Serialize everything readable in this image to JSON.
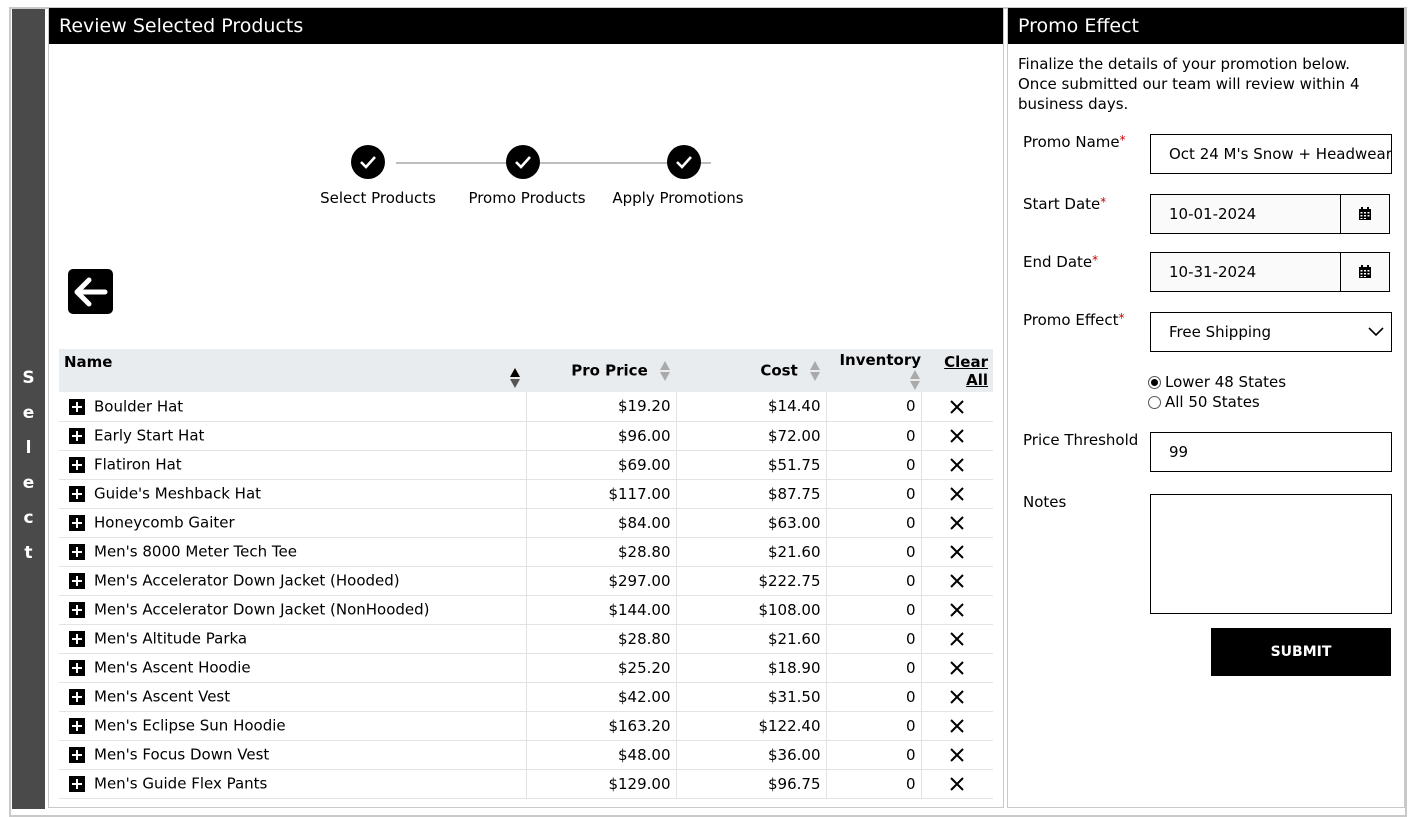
{
  "side_tab": {
    "letters": [
      "S",
      "e",
      "l",
      "e",
      "c",
      "t"
    ]
  },
  "left_panel": {
    "title": "Review Selected Products",
    "steps": [
      {
        "label": "Select Products",
        "done": true
      },
      {
        "label": "Promo Products",
        "done": true
      },
      {
        "label": "Apply Promotions",
        "done": true
      }
    ],
    "back_icon": "arrow-left-icon",
    "table": {
      "headers": {
        "name": "Name",
        "pro_price": "Pro Price",
        "cost": "Cost",
        "inventory": "Inventory",
        "clear_all": "Clear All"
      },
      "rows": [
        {
          "name": "Boulder Hat",
          "pro_price": "$19.20",
          "cost": "$14.40",
          "inventory": "0"
        },
        {
          "name": "Early Start Hat",
          "pro_price": "$96.00",
          "cost": "$72.00",
          "inventory": "0"
        },
        {
          "name": "Flatiron Hat",
          "pro_price": "$69.00",
          "cost": "$51.75",
          "inventory": "0"
        },
        {
          "name": "Guide's Meshback Hat",
          "pro_price": "$117.00",
          "cost": "$87.75",
          "inventory": "0"
        },
        {
          "name": "Honeycomb Gaiter",
          "pro_price": "$84.00",
          "cost": "$63.00",
          "inventory": "0"
        },
        {
          "name": "Men's 8000 Meter Tech Tee",
          "pro_price": "$28.80",
          "cost": "$21.60",
          "inventory": "0"
        },
        {
          "name": "Men's Accelerator Down Jacket (Hooded)",
          "pro_price": "$297.00",
          "cost": "$222.75",
          "inventory": "0"
        },
        {
          "name": "Men's Accelerator Down Jacket (NonHooded)",
          "pro_price": "$144.00",
          "cost": "$108.00",
          "inventory": "0"
        },
        {
          "name": "Men's Altitude Parka",
          "pro_price": "$28.80",
          "cost": "$21.60",
          "inventory": "0"
        },
        {
          "name": "Men's Ascent Hoodie",
          "pro_price": "$25.20",
          "cost": "$18.90",
          "inventory": "0"
        },
        {
          "name": "Men's Ascent Vest",
          "pro_price": "$42.00",
          "cost": "$31.50",
          "inventory": "0"
        },
        {
          "name": "Men's Eclipse Sun Hoodie",
          "pro_price": "$163.20",
          "cost": "$122.40",
          "inventory": "0"
        },
        {
          "name": "Men's Focus Down Vest",
          "pro_price": "$48.00",
          "cost": "$36.00",
          "inventory": "0"
        },
        {
          "name": "Men's Guide Flex Pants",
          "pro_price": "$129.00",
          "cost": "$96.75",
          "inventory": "0"
        }
      ]
    }
  },
  "right_panel": {
    "title": "Promo Effect",
    "intro": "Finalize the details of your promotion below. Once submitted our team will review within 4 business days.",
    "promo_name": {
      "label": "Promo Name",
      "value": "Oct 24 M's Snow + Headwear"
    },
    "start_date": {
      "label": "Start Date",
      "value": "10-01-2024"
    },
    "end_date": {
      "label": "End Date",
      "value": "10-31-2024"
    },
    "promo_effect": {
      "label": "Promo Effect",
      "value": "Free Shipping"
    },
    "shipping_options": [
      {
        "label": "Lower 48 States",
        "selected": true
      },
      {
        "label": "All 50 States",
        "selected": false
      }
    ],
    "price_threshold": {
      "label": "Price Threshold",
      "value": "99"
    },
    "notes": {
      "label": "Notes",
      "value": ""
    },
    "required_mark": "*",
    "submit_label": "SUBMIT"
  }
}
